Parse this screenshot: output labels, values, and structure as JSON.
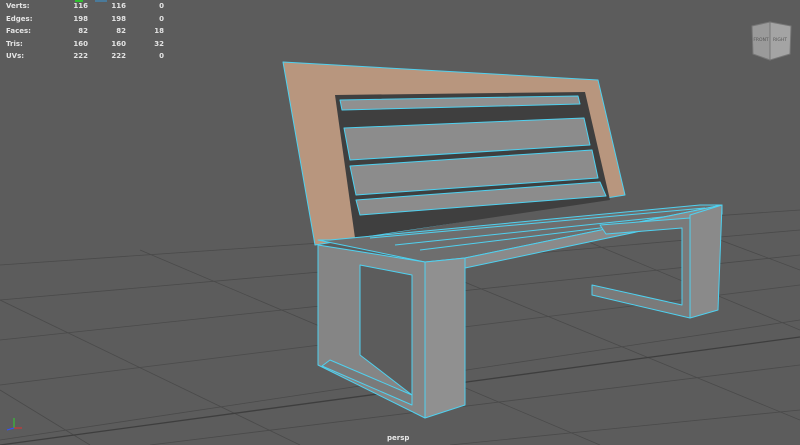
{
  "stats": {
    "rows": [
      {
        "label": "Verts:",
        "values": [
          "116",
          "116",
          "0"
        ]
      },
      {
        "label": "Edges:",
        "values": [
          "198",
          "198",
          "0"
        ]
      },
      {
        "label": "Faces:",
        "values": [
          "82",
          "82",
          "18"
        ]
      },
      {
        "label": "Tris:",
        "values": [
          "160",
          "160",
          "32"
        ]
      },
      {
        "label": "UVs:",
        "values": [
          "222",
          "222",
          "0"
        ]
      }
    ]
  },
  "viewcube": {
    "front": "FRONT",
    "right": "RIGHT"
  },
  "camera": "persp",
  "colors": {
    "background": "#5c5c5c",
    "wire": "#4fd1f0",
    "selected": "#b8967e",
    "mesh": "#8a8a8a"
  }
}
